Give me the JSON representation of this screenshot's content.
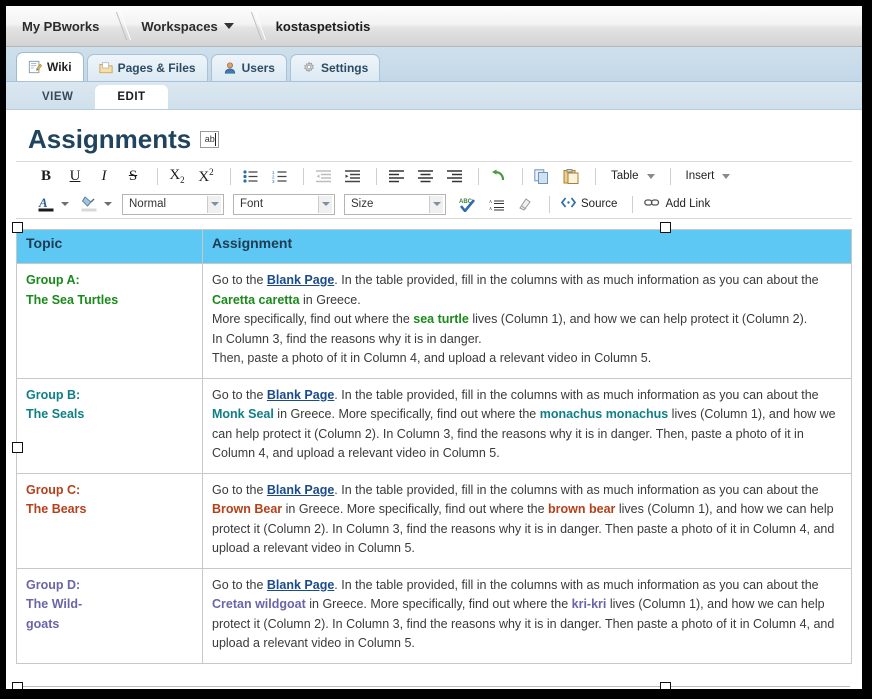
{
  "breadcrumb": {
    "items": [
      {
        "label": "My PBworks",
        "has_caret": false
      },
      {
        "label": "Workspaces",
        "has_caret": true
      },
      {
        "label": "kostaspetsiotis",
        "has_caret": false
      }
    ]
  },
  "app_tabs": [
    {
      "label": "Wiki",
      "icon": "pencil-page-icon",
      "active": true
    },
    {
      "label": "Pages & Files",
      "icon": "folder-icon",
      "active": false
    },
    {
      "label": "Users",
      "icon": "user-icon",
      "active": false
    },
    {
      "label": "Settings",
      "icon": "gear-icon",
      "active": false
    }
  ],
  "sub_tabs": [
    {
      "label": "VIEW",
      "active": false
    },
    {
      "label": "EDIT",
      "active": true
    }
  ],
  "page": {
    "title": "Assignments",
    "title_icon": "ab-text-cursor-icon"
  },
  "toolbar": {
    "row1": [
      {
        "name": "bold-button",
        "label": "B"
      },
      {
        "name": "underline-button",
        "label": "U"
      },
      {
        "name": "italic-button",
        "label": "I"
      },
      {
        "name": "strikethrough-button",
        "label": "S"
      },
      {
        "name": "subscript-button",
        "label": "X₂"
      },
      {
        "name": "superscript-button",
        "label": "X²"
      },
      {
        "name": "bulleted-list-button",
        "label": "☰"
      },
      {
        "name": "numbered-list-button",
        "label": "☰"
      },
      {
        "name": "outdent-button",
        "label": "≡"
      },
      {
        "name": "indent-button",
        "label": "≡"
      },
      {
        "name": "align-left-button",
        "label": "≡"
      },
      {
        "name": "align-center-button",
        "label": "≡"
      },
      {
        "name": "align-right-button",
        "label": "≡"
      },
      {
        "name": "undo-button",
        "label": "↶"
      },
      {
        "name": "copy-button",
        "label": "❐"
      },
      {
        "name": "paste-button",
        "label": "Ὄb"
      }
    ],
    "table_menu": "Table",
    "insert_menu": "Insert",
    "style_select": "Normal",
    "font_select": "Font",
    "size_select": "Size",
    "source_label": "Source",
    "add_link_label": "Add Link"
  },
  "table": {
    "headers": [
      "Topic",
      "Assignment"
    ],
    "header_bg": "#5ec8f5",
    "rows": [
      {
        "color": "#1a8a1a",
        "topic_line1": "Group A:",
        "topic_line2": "The Sea Turtles",
        "paragraphs": [
          [
            {
              "t": "Go to the ",
              "s": "n"
            },
            {
              "t": "Blank Page",
              "s": "link"
            },
            {
              "t": ". In the table provided, fill in the columns with as much information as you can about the ",
              "s": "n"
            },
            {
              "t": "Caretta caretta",
              "s": "b"
            },
            {
              "t": " in Greece.",
              "s": "n"
            }
          ],
          [
            {
              "t": "More specifically, find out where the ",
              "s": "n"
            },
            {
              "t": "sea turtle",
              "s": "b"
            },
            {
              "t": " lives (Column 1), and how we can help protect it (Column 2).",
              "s": "n"
            }
          ],
          [
            {
              "t": "In Column 3, find the reasons why it is in danger.",
              "s": "n"
            }
          ],
          [
            {
              "t": "Then, paste a photo of it in Column 4, and upload a relevant video in Column 5.",
              "s": "n"
            }
          ]
        ]
      },
      {
        "color": "#0f7f86",
        "topic_line1": "Group B:",
        "topic_line2": "The Seals",
        "paragraphs": [
          [
            {
              "t": "Go to the ",
              "s": "n"
            },
            {
              "t": "Blank Page",
              "s": "link"
            },
            {
              "t": ". In the table provided, fill in the columns with as much information as you can about the ",
              "s": "n"
            },
            {
              "t": "Monk Seal",
              "s": "b"
            },
            {
              "t": " in Greece. More specifically, find out where the ",
              "s": "n"
            },
            {
              "t": "monachus monachus",
              "s": "b"
            },
            {
              "t": " lives (Column 1), and how we can help protect it (Column 2). In Column 3, find the reasons why it is in danger. Then, paste a photo of it in Column 4, and upload a relevant video in Column 5.",
              "s": "n"
            }
          ]
        ]
      },
      {
        "color": "#b5401a",
        "topic_line1": "Group C:",
        "topic_line2": "The Bears",
        "paragraphs": [
          [
            {
              "t": "Go to the ",
              "s": "n"
            },
            {
              "t": "Blank Page",
              "s": "link"
            },
            {
              "t": ". In the table provided, fill in the columns with as much information as you can about the ",
              "s": "n"
            },
            {
              "t": "Brown Bear",
              "s": "b"
            },
            {
              "t": " in Greece. More specifically, find out where the ",
              "s": "n"
            },
            {
              "t": "brown bear",
              "s": "b"
            },
            {
              "t": " lives (Column 1), and how we can help protect it (Column 2). In Column 3, find the reasons why it is in danger. Then paste a photo of it in Column 4, and upload a relevant video in Column 5.",
              "s": "n"
            }
          ]
        ]
      },
      {
        "color": "#6a65a8",
        "topic_line1": "Group D:",
        "topic_line2": "The Wild-",
        "topic_line3": "goats",
        "paragraphs": [
          [
            {
              "t": "Go to the ",
              "s": "n"
            },
            {
              "t": "Blank Page",
              "s": "link"
            },
            {
              "t": ". In the table provided, fill in the columns with as much information as you can about the ",
              "s": "n"
            },
            {
              "t": "Cretan wildgoat",
              "s": "b"
            },
            {
              "t": " in Greece. More specifically, find out where the ",
              "s": "n"
            },
            {
              "t": "kri-kri",
              "s": "b"
            },
            {
              "t": "  lives (Column 1), and how we can help protect it (Column 2). In Column 3, find the reasons why it is in danger. Then paste a photo of it in Column 4, and upload a relevant video in Column 5.",
              "s": "n"
            }
          ]
        ]
      }
    ]
  }
}
